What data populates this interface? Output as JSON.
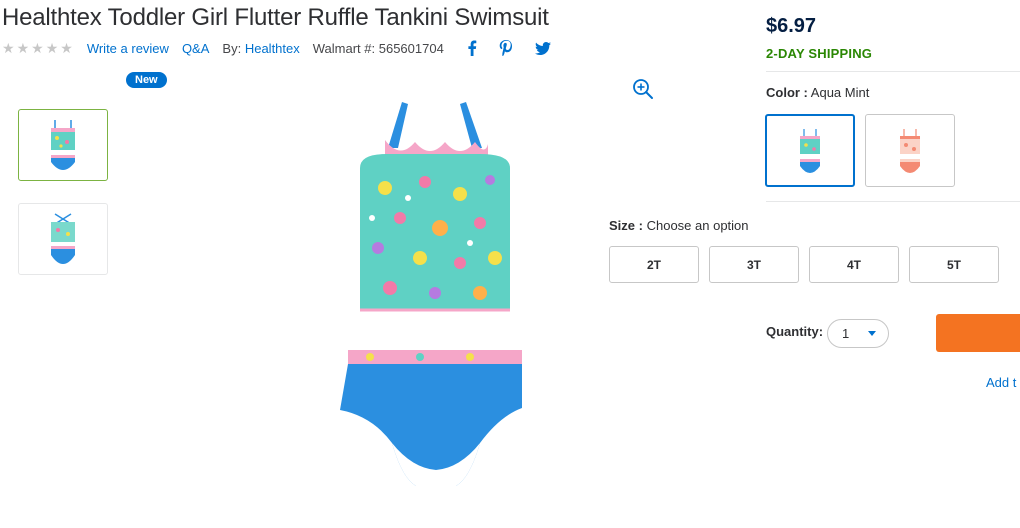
{
  "product": {
    "title": "Healthtex Toddler Girl Flutter Ruffle Tankini Swimsuit",
    "write_review": "Write a review",
    "qa": "Q&A",
    "by_label": "By:",
    "brand": "Healthtex",
    "walmart_label": "Walmart #:",
    "walmart_number": "565601704",
    "rating_stars": 0,
    "new_badge": "New"
  },
  "icons": {
    "facebook": "facebook-icon",
    "pinterest": "pinterest-icon",
    "twitter": "twitter-icon",
    "zoom": "zoom-in-icon",
    "star": "star-icon"
  },
  "buybox": {
    "price": "$6.97",
    "shipping": "2-DAY SHIPPING",
    "color_label": "Color :",
    "color_value": "Aqua Mint",
    "swatches": [
      "Aqua Mint",
      "Coral"
    ],
    "size_label": "Size :",
    "size_placeholder": "Choose an option",
    "sizes": [
      "2T",
      "3T",
      "4T",
      "5T"
    ],
    "quantity_label": "Quantity:",
    "quantity_value": "1",
    "add_to_list": "Add t"
  },
  "colors": {
    "link": "#0071ce",
    "price": "#041e42",
    "shipping": "#2a8703",
    "add_to_cart": "#f47321",
    "selected_thumb": "#7cb342",
    "aqua": "#5fd1c4",
    "blue": "#2b8fe0"
  }
}
